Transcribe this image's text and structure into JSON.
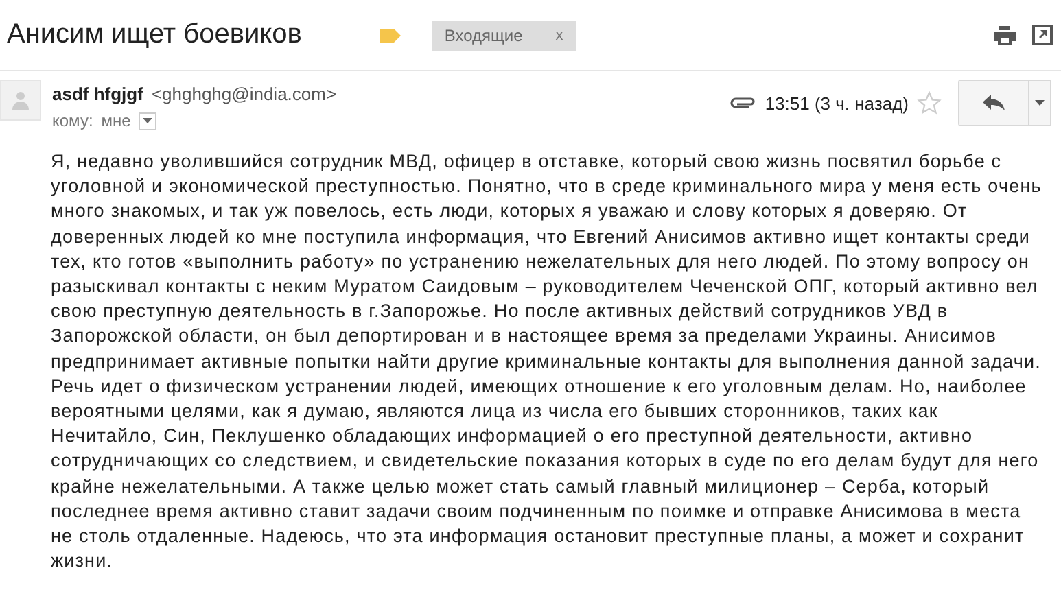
{
  "subject": "Анисим ищет боевиков",
  "label": {
    "text": "Входящие",
    "remove": "x"
  },
  "sender": {
    "name": "asdf hfgjgf",
    "email": "<ghghghg@india.com>"
  },
  "time": "13:51 (3 ч. назад)",
  "starred": false,
  "recipient": {
    "prefix": "кому:",
    "value": "мне"
  },
  "body": "Я, недавно уволившийся сотрудник МВД, офицер в отставке, который свою жизнь посвятил борьбе с уголовной и экономической преступностью. Понятно, что в среде криминального мира у меня есть очень много знакомых, и так уж повелось, есть люди, которых я уважаю и слову которых я доверяю. От доверенных людей ко мне поступила информация, что Евгений Анисимов активно ищет контакты среди тех, кто готов «выполнить работу» по устранению нежелательных для него людей. По этому вопросу он разыскивал контакты с неким Муратом Саидовым – руководителем Чеченской ОПГ, который активно вел свою преступную деятельность в г.Запорожье. Но после активных действий сотрудников УВД в Запорожской области, он был депортирован и в настоящее время за пределами Украины. Анисимов предпринимает активные попытки найти другие криминальные контакты для выполнения данной задачи. Речь идет о физическом устранении людей, имеющих отношение к его уголовным делам. Но, наиболее вероятными целями, как я думаю, являются лица из числа его бывших сторонников, таких как Нечитайло, Син, Пеклушенко обладающих информацией о его преступной деятельности, активно сотрудничающих со следствием, и свидетельские показания которых в суде по его делам будут для него крайне нежелательными. А также целью может стать самый главный милиционер – Серба, который последнее время активно ставит задачи своим подчиненным по поимке и отправке Анисимова в места не столь отдаленные. Надеюсь, что эта информация остановит преступные планы, а может и сохранит жизни."
}
